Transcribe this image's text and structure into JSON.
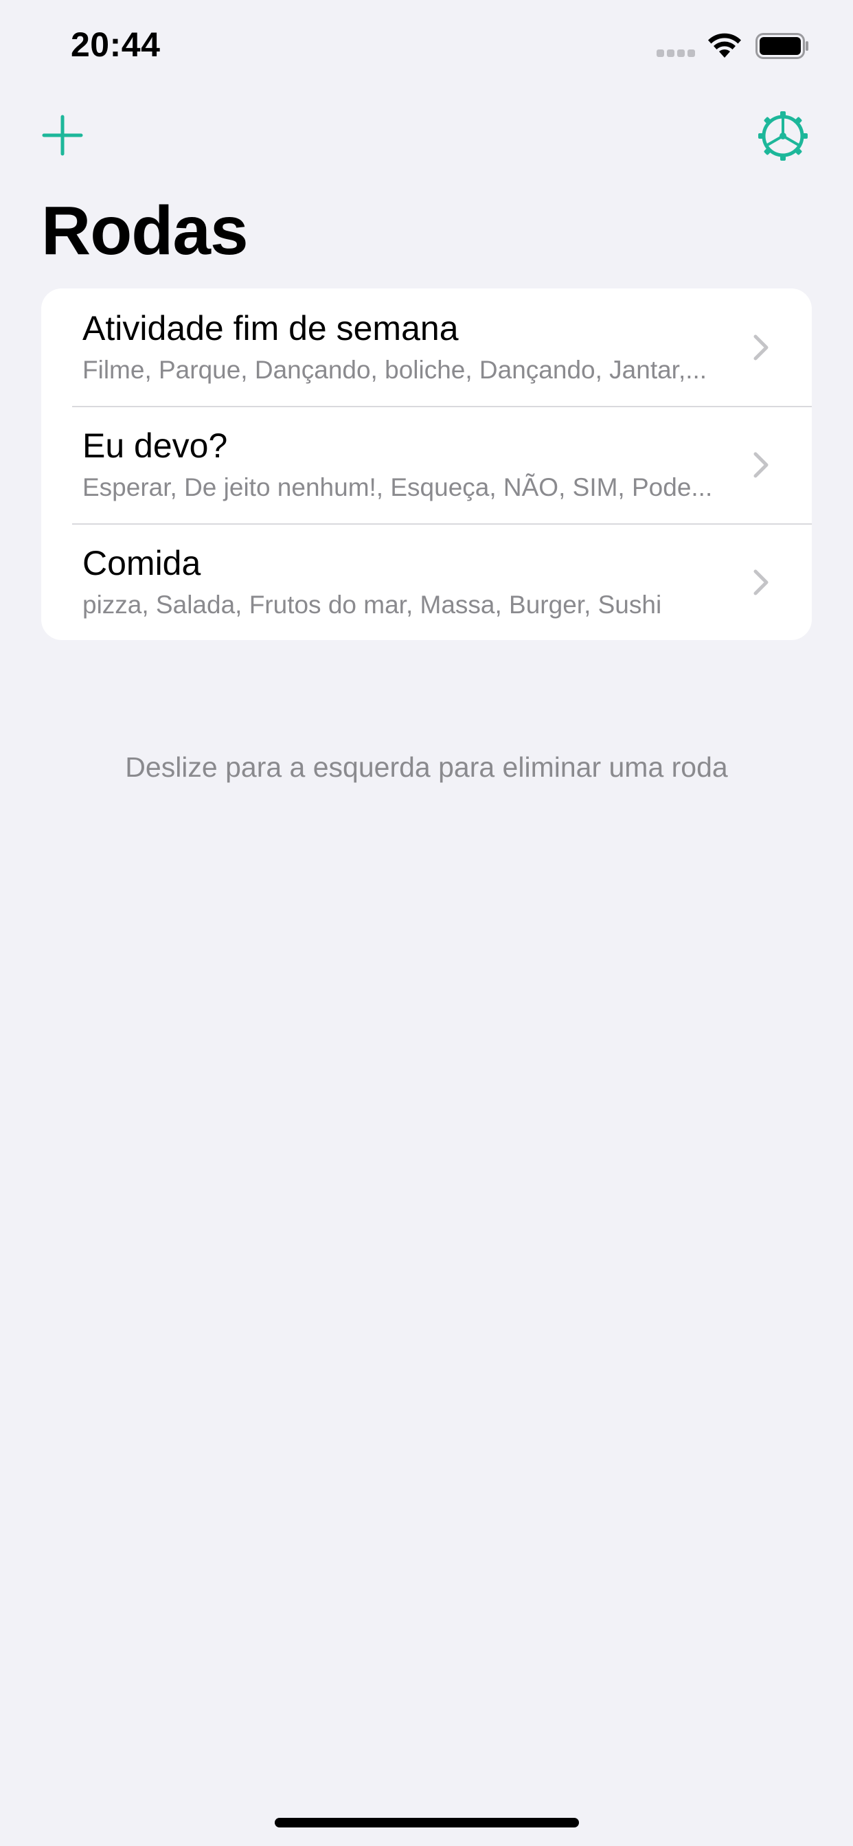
{
  "status_bar": {
    "time": "20:44"
  },
  "nav": {
    "add_icon": "plus-icon",
    "settings_icon": "wheel-gear-icon",
    "accent_color": "#1db79a"
  },
  "page": {
    "title": "Rodas"
  },
  "wheels": [
    {
      "title": "Atividade fim de semana",
      "options": "Filme, Parque, Dançando, boliche, Dançando, Jantar,..."
    },
    {
      "title": "Eu devo?",
      "options": "Esperar, De jeito nenhum!, Esqueça, NÃO, SIM, Pode..."
    },
    {
      "title": "Comida",
      "options": "pizza, Salada, Frutos do mar, Massa, Burger, Sushi"
    }
  ],
  "hint": "Deslize para a esquerda para eliminar uma roda"
}
